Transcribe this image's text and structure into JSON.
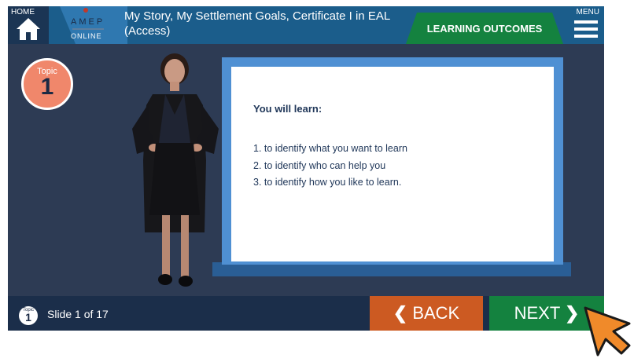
{
  "header": {
    "home_label": "HOME",
    "logo_text_top": "AMEP",
    "logo_text_bottom": "ONLINE",
    "title": "My Story, My Settlement Goals, Certificate I in EAL (Access)",
    "outcomes_label": "LEARNING OUTCOMES",
    "menu_label": "MENU"
  },
  "topic": {
    "label": "Topic",
    "number": "1"
  },
  "board": {
    "heading": "You will learn:",
    "items": [
      "1.  to identify what you want to learn",
      "2.  to identify who can help you",
      "3.  to identify how you like to learn."
    ]
  },
  "footer": {
    "topic_label": "Topic",
    "topic_number": "1",
    "slide_text": "Slide 1 of 17",
    "back_label": "BACK",
    "next_label": "NEXT"
  },
  "colors": {
    "header": "#1b5d8b",
    "background": "#2d3b54",
    "accent_green": "#14823f",
    "accent_orange": "#cc5a22",
    "topic_badge": "#f0876b",
    "board_blue": "#4f90d3"
  },
  "icons": [
    "home-icon",
    "menu-icon",
    "chevron-left-icon",
    "chevron-right-icon",
    "pointer-cursor-icon"
  ]
}
